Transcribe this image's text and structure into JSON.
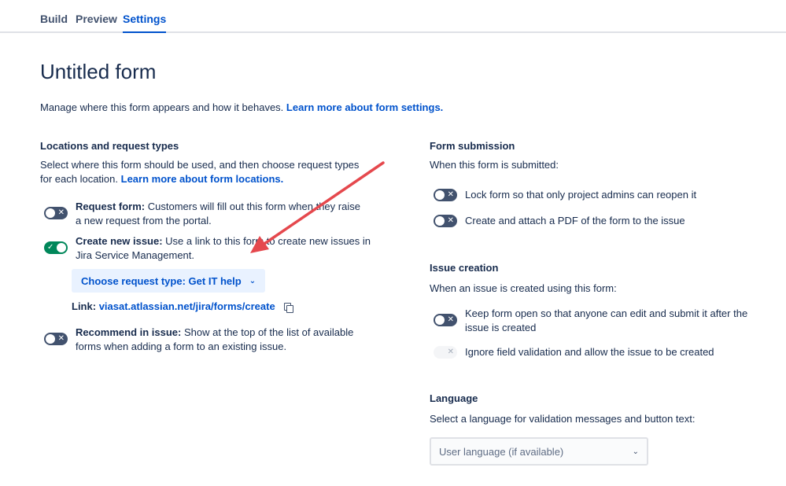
{
  "tabs": [
    {
      "label": "Build"
    },
    {
      "label": "Preview"
    },
    {
      "label": "Settings"
    }
  ],
  "title": "Untitled form",
  "intro": {
    "text": "Manage where this form appears and how it behaves.",
    "link": "Learn more about form settings."
  },
  "locations": {
    "heading": "Locations and request types",
    "desc_line1": "Select where this form should be used, and then choose request types",
    "desc_line2": "for each location.",
    "desc_link": "Learn more about form locations.",
    "items": [
      {
        "title": "Request form:",
        "line1": "Customers will fill out this form when they raise",
        "line2": "a new request from the portal.",
        "on": false
      },
      {
        "title": "Create new issue:",
        "line1": "Use a link to this form to create new issues in",
        "line2": "Jira Service Management.",
        "on": true
      },
      {
        "title": "Recommend in issue:",
        "line1": "Show at the top of the list of available",
        "line2": "forms when adding a form to an existing issue.",
        "on": false
      }
    ],
    "request_type_label": "Choose request type:",
    "request_type_value": "Get IT help",
    "link_label": "Link:",
    "link_value": "viasat.atlassian.net/jira/forms/create"
  },
  "submission": {
    "heading": "Form submission",
    "desc": "When this form is submitted:",
    "items": [
      {
        "label": "Lock form so that only project admins can reopen it",
        "on": false
      },
      {
        "label": "Create and attach a PDF of the form to the issue",
        "on": false
      }
    ]
  },
  "issue_creation": {
    "heading": "Issue creation",
    "desc": "When an issue is created using this form:",
    "items": [
      {
        "line1": "Keep form open so that anyone can edit and submit it after the",
        "line2": "issue is created",
        "on": false
      },
      {
        "line1": "Ignore field validation and allow the issue to be created",
        "on": false,
        "disabled": true
      }
    ]
  },
  "language": {
    "heading": "Language",
    "desc": "Select a language for validation messages and button text:",
    "selected": "User language (if available)"
  },
  "glyphs": {
    "x": "✕",
    "check": "✓",
    "chevron": "⌄"
  },
  "colors": {
    "accent": "#0052cc",
    "toggle_on": "#00875a",
    "toggle_off": "#42526e",
    "annotation_arrow": "#e5484d"
  }
}
